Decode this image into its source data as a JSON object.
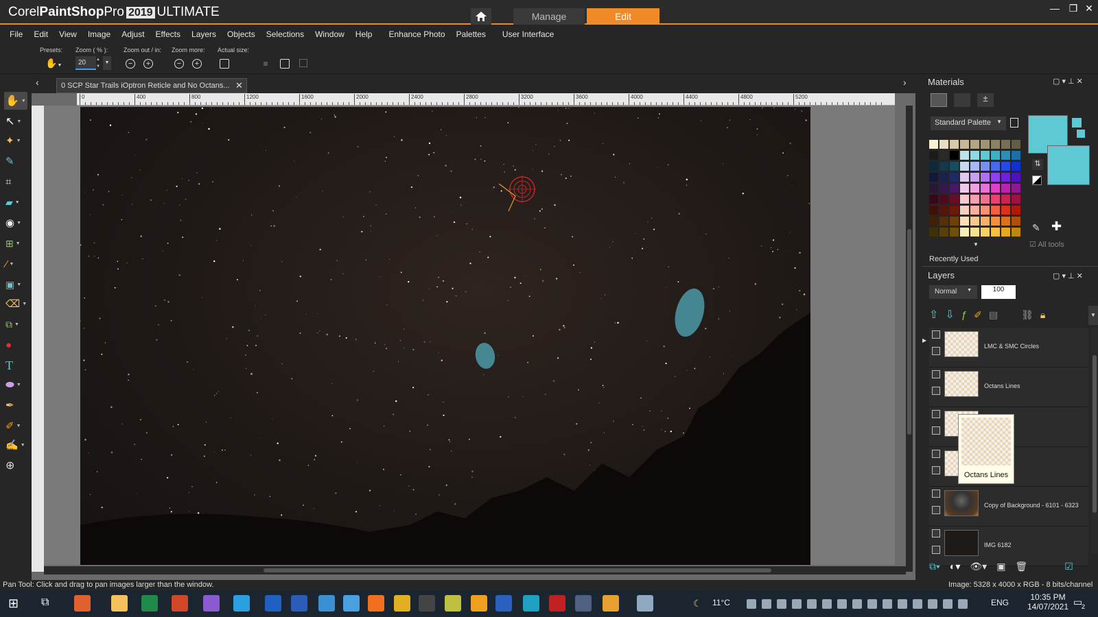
{
  "titlebar": {
    "logo_corel": "Corel",
    "logo_product": "PaintShop",
    "logo_pro": "Pro",
    "logo_version": "2019",
    "logo_edition": "ULTIMATE",
    "tab_manage": "Manage",
    "tab_edit": "Edit",
    "minimize": "—",
    "restore": "❐",
    "close": "✕"
  },
  "menu": [
    "File",
    "Edit",
    "View",
    "Image",
    "Adjust",
    "Effects",
    "Layers",
    "Objects",
    "Selections",
    "Window",
    "Help",
    "Enhance Photo",
    "Palettes",
    "User Interface"
  ],
  "toolbar": {
    "presets_label": "Presets:",
    "zoom_label": "Zoom ( % ):",
    "zoom_value": "20",
    "zoom_out_in_label": "Zoom out / in:",
    "zoom_more_label": "Zoom more:",
    "actual_size_label": "Actual size:"
  },
  "document": {
    "tab_title": "0 SCP Star Trails iOptron Reticle and No Octans...",
    "ruler_ticks": [
      "0",
      "400",
      "800",
      "1200",
      "1600",
      "2000",
      "2400",
      "2800",
      "3200",
      "3600",
      "4000",
      "4400",
      "4800",
      "5200"
    ]
  },
  "materials": {
    "title": "Materials",
    "palette_select": "Standard Palette",
    "all_tools": "All tools",
    "recently_used": "Recently Used",
    "fg_color": "#5ec8d4",
    "bg_color": "#5ec8d4"
  },
  "layers": {
    "title": "Layers",
    "blend_mode": "Normal",
    "opacity": "100",
    "items": [
      {
        "name": "LMC & SMC Circles"
      },
      {
        "name": "Octans Lines"
      },
      {
        "name": ""
      },
      {
        "name": ""
      },
      {
        "name": "Copy of Background - 6101 - 6323"
      },
      {
        "name": "IMG 6182"
      }
    ],
    "tooltip": "Octans Lines"
  },
  "status": {
    "left": "Pan Tool: Click and drag to pan images larger than the window.",
    "right": "Image:  5328 x 4000 x RGB - 8 bits/channel"
  },
  "taskbar": {
    "weather": "11°C",
    "lang": "ENG",
    "time": "10:35 PM",
    "date": "14/07/2021",
    "notifications": "2"
  }
}
